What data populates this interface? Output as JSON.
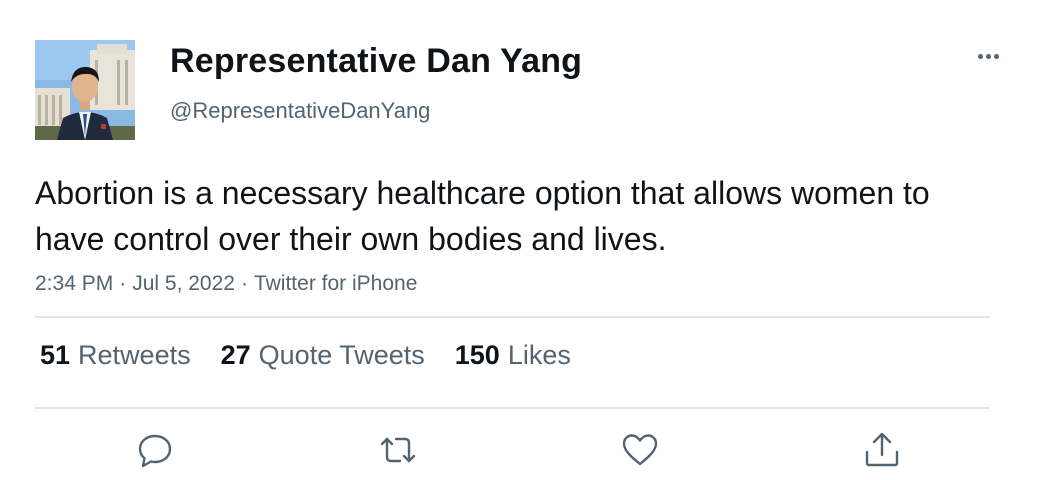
{
  "user": {
    "display_name": "Representative Dan Yang",
    "handle": "@RepresentativeDanYang"
  },
  "tweet": {
    "text": "Abortion is a necessary healthcare option that allows women to have control over their own bodies and lives.",
    "time": "2:34 PM",
    "date": "Jul 5, 2022",
    "source": "Twitter for iPhone",
    "separator": "·"
  },
  "stats": {
    "retweets": {
      "count": "51",
      "label": "Retweets"
    },
    "quote_tweets": {
      "count": "27",
      "label": "Quote Tweets"
    },
    "likes": {
      "count": "150",
      "label": "Likes"
    }
  },
  "actions": [
    "reply-icon",
    "retweet-icon",
    "like-icon",
    "share-icon"
  ],
  "colors": {
    "text_primary": "#0f1419",
    "text_secondary": "#536471",
    "divider": "#e1e5e8"
  }
}
